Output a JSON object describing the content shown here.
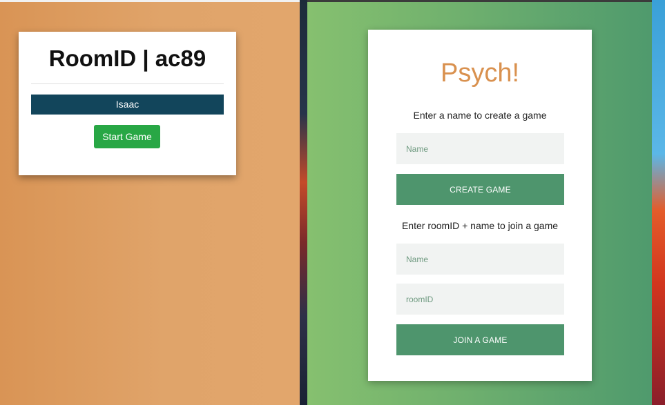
{
  "room_window": {
    "title": "RoomID | ac89",
    "players": [
      "Isaac"
    ],
    "start_button_label": "Start Game"
  },
  "psych_window": {
    "title": "Psych!",
    "create_section": {
      "instruction": "Enter a name to create a game",
      "name_placeholder": "Name",
      "button_label": "CREATE GAME"
    },
    "join_section": {
      "instruction": "Enter roomID + name to join a game",
      "name_placeholder": "Name",
      "room_placeholder": "roomID",
      "button_label": "JOIN A GAME"
    }
  },
  "colors": {
    "left_background": "#d99455",
    "right_background": "#6fb06e",
    "accent_orange": "#d9914f",
    "accent_green": "#4e956d",
    "player_bar": "#12455b",
    "start_button": "#28a745"
  }
}
